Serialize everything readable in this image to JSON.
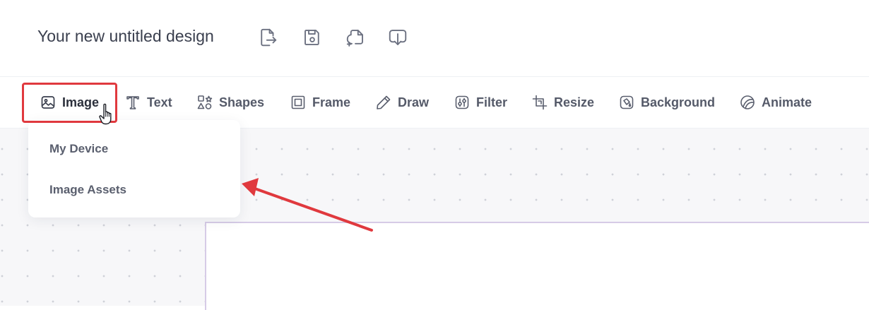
{
  "header": {
    "title": "Your new untitled design",
    "icons": [
      "export-icon",
      "save-icon",
      "duplicate-icon",
      "download-icon"
    ]
  },
  "toolbar": {
    "items": [
      {
        "label": "Image",
        "icon": "image-icon"
      },
      {
        "label": "Text",
        "icon": "text-icon"
      },
      {
        "label": "Shapes",
        "icon": "shapes-icon"
      },
      {
        "label": "Frame",
        "icon": "frame-icon"
      },
      {
        "label": "Draw",
        "icon": "pencil-icon"
      },
      {
        "label": "Filter",
        "icon": "filter-icon"
      },
      {
        "label": "Resize",
        "icon": "crop-icon"
      },
      {
        "label": "Background",
        "icon": "paint-bucket-icon"
      },
      {
        "label": "Animate",
        "icon": "animate-icon"
      }
    ],
    "active": "Image"
  },
  "dropdown": {
    "items": [
      {
        "label": "My Device"
      },
      {
        "label": "Image Assets"
      }
    ]
  },
  "colors": {
    "highlight": "#e0393e",
    "arrow": "#e0393e",
    "artboard_border": "#d6cbe6",
    "canvas_bg": "#f7f7f9"
  }
}
